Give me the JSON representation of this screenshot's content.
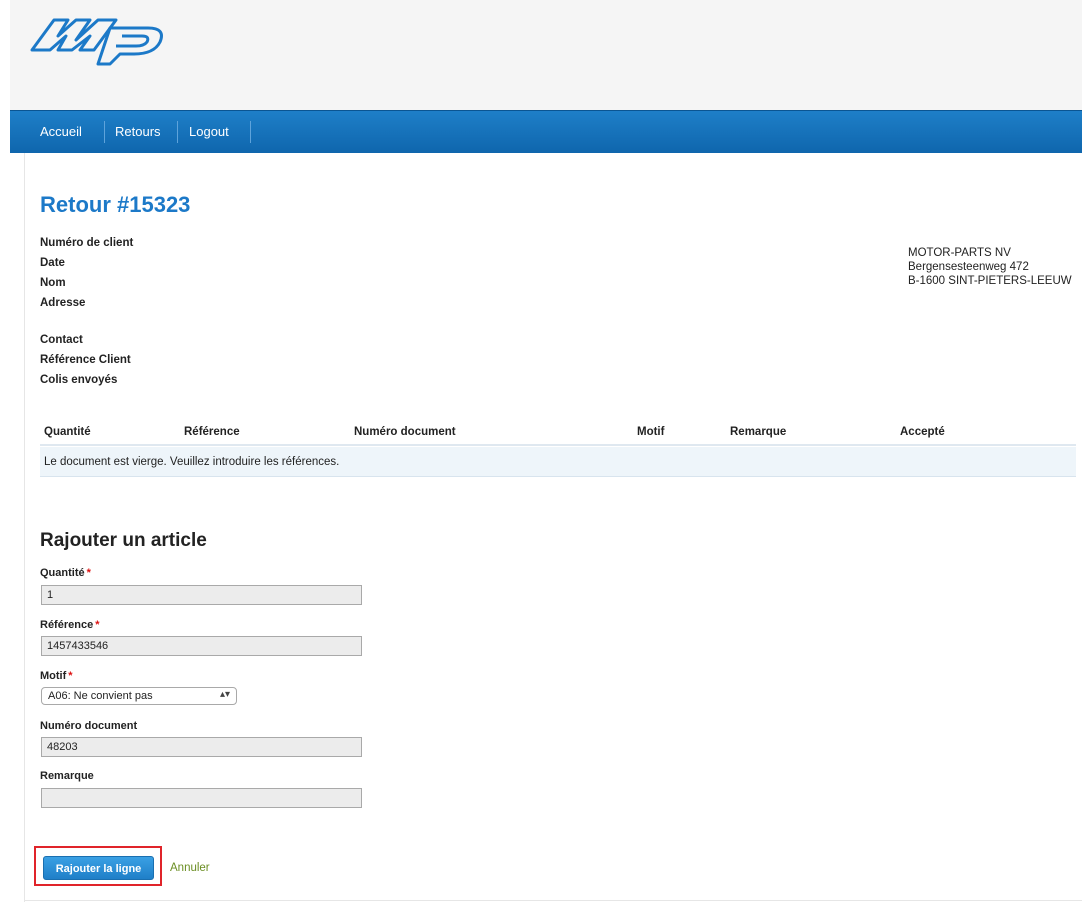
{
  "nav": {
    "items": [
      "Accueil",
      "Retours",
      "Logout"
    ]
  },
  "page": {
    "title": "Retour #15323"
  },
  "info": {
    "labels": [
      "Numéro de client",
      "Date",
      "Nom",
      "Adresse",
      "Contact",
      "Référence Client",
      "Colis envoyés"
    ]
  },
  "address": [
    "MOTOR-PARTS NV",
    "Bergensesteenweg 472",
    "B-1600 SINT-PIETERS-LEEUW"
  ],
  "table": {
    "headers": [
      "Quantité",
      "Référence",
      "Numéro document",
      "Motif",
      "Remarque",
      "Accepté"
    ],
    "empty_message": "Le document est vierge. Veuillez introduire les références."
  },
  "form": {
    "title": "Rajouter un article",
    "required_mark": "*",
    "quantity": {
      "label": "Quantité",
      "value": "1"
    },
    "reference": {
      "label": "Référence",
      "value": "1457433546"
    },
    "motif": {
      "label": "Motif",
      "selected": "A06: Ne convient pas"
    },
    "document": {
      "label": "Numéro document",
      "value": "48203"
    },
    "remark": {
      "label": "Remarque",
      "value": ""
    },
    "submit_label": "Rajouter la ligne",
    "cancel_label": "Annuler"
  },
  "colors": {
    "brand_blue": "#1c79c8",
    "highlight_red": "#e0242a",
    "cancel_green": "#6b8e23"
  }
}
